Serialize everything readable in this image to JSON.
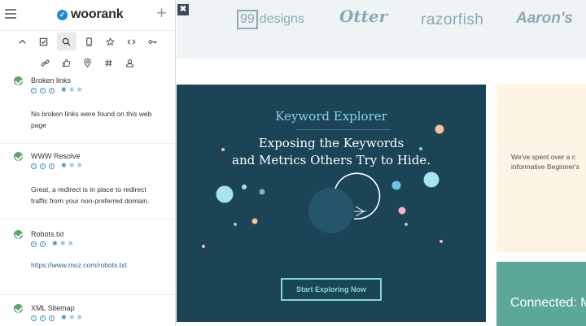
{
  "sidebar": {
    "logo": "woorank",
    "logo_mark": "✓",
    "toolbar_row1": [
      "chevron-up-icon",
      "checkbox-icon",
      "search-icon",
      "mobile-icon",
      "star-icon",
      "code-icon",
      "key-icon"
    ],
    "toolbar_row2": [
      "link-icon",
      "thumbs-up-icon",
      "location-pin-icon",
      "hash-icon",
      "user-icon"
    ],
    "items": [
      {
        "title": "Broken links",
        "text": "No broken links were found on this web page"
      },
      {
        "title": "WWW Resolve",
        "text": "Great, a redirect is in place to redirect traffic from your non-preferred domain."
      },
      {
        "title": "Robots.txt",
        "text": "https://www.moz.com/robots.txt"
      },
      {
        "title": "XML Sitemap",
        "text": ""
      }
    ]
  },
  "close_label": "✖",
  "logos": {
    "brand_99_box": "99",
    "brand_99_text": "designs",
    "brand_otter": "Otter",
    "brand_razor": "razorfish",
    "brand_aarons": "Aaron's"
  },
  "keyword_card": {
    "heading": "Keyword Explorer",
    "subtitle_line1": "Exposing the Keywords",
    "subtitle_line2": "and Metrics Others Try to Hide.",
    "button": "Start Exploring Now",
    "colors": {
      "bg": "#1b4457",
      "accent": "#7fd9c6",
      "heading": "#8ed3df"
    }
  },
  "beige_card": {
    "line1": "We've spent over a c",
    "line2": "informative Beginner's"
  },
  "green_card": {
    "text": "Connected: M"
  },
  "colors": {
    "check": "#5aa667",
    "dot": "#3a8fc9",
    "link": "#2a5f8c",
    "logos_bg": "#eef4f5"
  }
}
